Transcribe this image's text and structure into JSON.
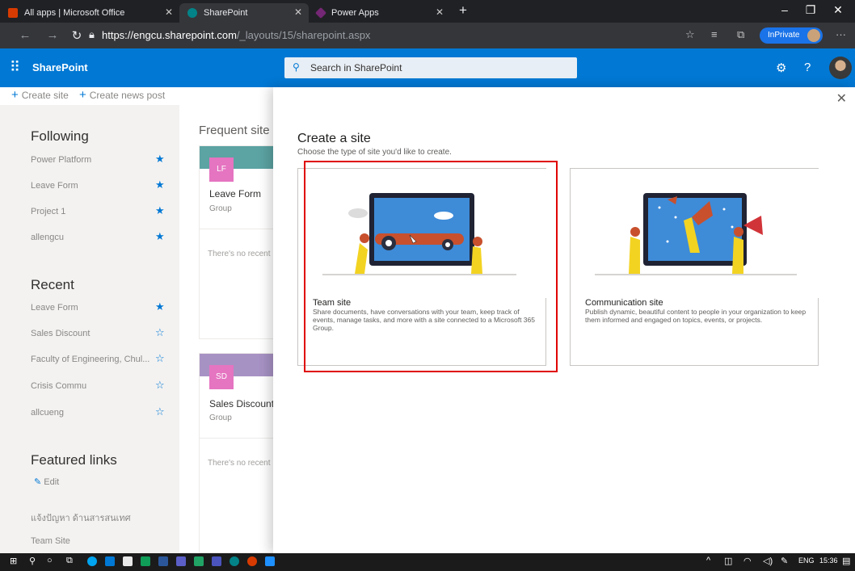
{
  "browser": {
    "tabs": [
      {
        "title": "All apps | Microsoft Office",
        "color": "#d83b01",
        "active": false
      },
      {
        "title": "SharePoint",
        "color": "#038387",
        "active": true
      },
      {
        "title": "Power Apps",
        "color": "#742774",
        "active": false
      }
    ],
    "new_tab": "+",
    "url_host": "https://engcu.sharepoint.com",
    "url_path": "/_layouts/15/sharepoint.aspx",
    "inprivate_label": "InPrivate",
    "window_controls": {
      "minimize": "–",
      "restore": "❐",
      "close": "✕"
    },
    "more": "···"
  },
  "suite": {
    "app_name": "SharePoint",
    "search_placeholder": "Search in SharePoint",
    "brand_color": "#0078d4"
  },
  "commands": {
    "create_site": "Create site",
    "create_news": "Create news post"
  },
  "nav": {
    "following_heading": "Following",
    "following": [
      {
        "label": "Power Platform",
        "starred": true
      },
      {
        "label": "Leave Form",
        "starred": true
      },
      {
        "label": "Project 1",
        "starred": true
      },
      {
        "label": "allengcu",
        "starred": true
      }
    ],
    "recent_heading": "Recent",
    "recent": [
      {
        "label": "Leave Form",
        "starred": true
      },
      {
        "label": "Sales Discount",
        "starred": false
      },
      {
        "label": "Faculty of Engineering, Chul...",
        "starred": false
      },
      {
        "label": "Crisis Commu",
        "starred": false
      },
      {
        "label": "allcueng",
        "starred": false
      }
    ],
    "featured_heading": "Featured links",
    "edit_label": "Edit",
    "featured": [
      "แจ้งปัญหา ด้านสารสนเทศ",
      "Team Site"
    ]
  },
  "frequent": {
    "title": "Frequent site",
    "cards": [
      {
        "initials": "LF",
        "name": "Leave Form",
        "type": "Group",
        "empty": "There's no recent",
        "band": "#5ca3a3",
        "logo": "#e574c1"
      },
      {
        "initials": "SD",
        "name": "Sales Discount",
        "type": "Group",
        "empty": "There's no recent",
        "band": "#a792c4",
        "logo": "#e574c1"
      }
    ]
  },
  "panel": {
    "title": "Create a site",
    "subtitle": "Choose the type of site you'd like to create.",
    "close": "✕",
    "options": [
      {
        "name": "Team site",
        "description": "Share documents, have conversations with your team, keep track of events, manage tasks, and more with a site connected to a Microsoft 365 Group."
      },
      {
        "name": "Communication site",
        "description": "Publish dynamic, beautiful content to people in your organization to keep them informed and engaged on topics, events, or projects."
      }
    ]
  },
  "taskbar": {
    "language": "ENG",
    "time": "15:36"
  }
}
